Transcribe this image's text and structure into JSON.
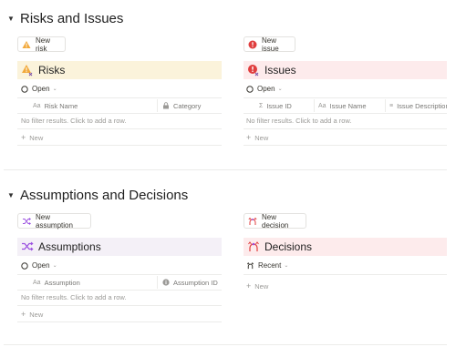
{
  "sections": {
    "risks_issues": {
      "title": "Risks and Issues"
    },
    "assumptions_decisions": {
      "title": "Assumptions and Decisions"
    }
  },
  "buttons": {
    "new_risk": "New risk",
    "new_issue": "New issue",
    "new_assumption": "New assumption",
    "new_decision": "New decision"
  },
  "databases": {
    "risks": {
      "title": "Risks",
      "color": "#fbf3db",
      "view": "Open",
      "columns": [
        "Risk Name",
        "Category"
      ],
      "empty": "No filter results. Click to add a row.",
      "new": "New"
    },
    "issues": {
      "title": "Issues",
      "color": "#fdebec",
      "view": "Open",
      "columns": [
        "Issue ID",
        "Issue Name",
        "Issue Description"
      ],
      "empty": "No filter results. Click to add a row.",
      "new": "New"
    },
    "assumptions": {
      "title": "Assumptions",
      "color": "#f4f0f7",
      "view": "Open",
      "columns": [
        "Assumption",
        "Assumption ID"
      ],
      "empty": "No filter results. Click to add a row.",
      "new": "New"
    },
    "decisions": {
      "title": "Decisions",
      "color": "#fdebec",
      "view": "Recent",
      "new": "New"
    }
  },
  "icons": {
    "toggle": "triangle-down-icon",
    "risk": "warning-triangle-icon",
    "issue": "exclamation-circle-icon",
    "assumption": "shuffle-icon",
    "decision": "fork-arrows-icon",
    "view_open": "circle-outline-icon",
    "view_recent": "recent-icon",
    "title_col": "text-aa-icon",
    "category_col": "lock-icon",
    "id_col": "sigma-icon",
    "desc_col": "lines-icon",
    "assumption_id_col": "info-circle-icon"
  }
}
